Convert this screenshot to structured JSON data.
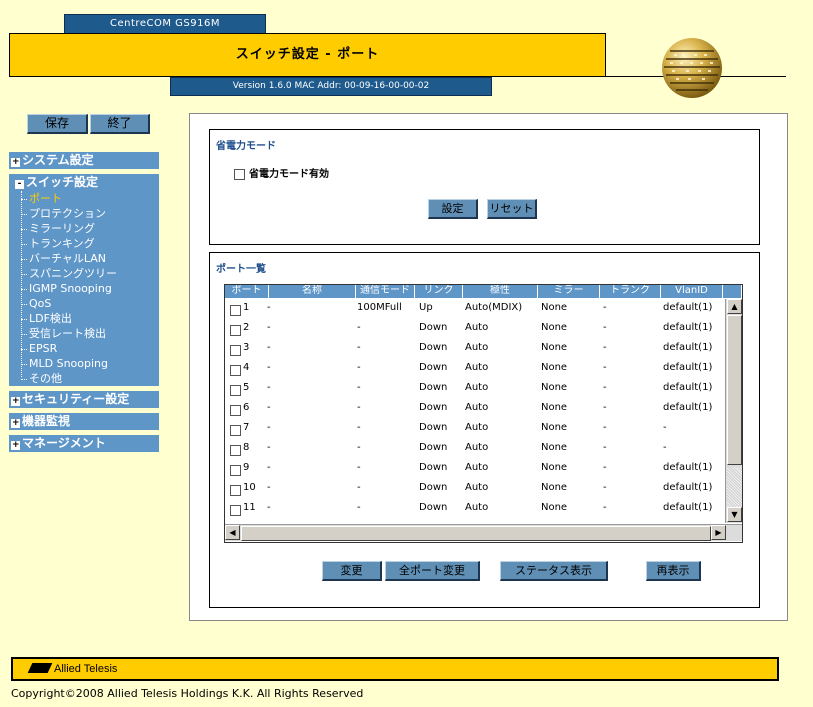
{
  "header": {
    "model": "CentreCOM GS916M",
    "title": "スイッチ設定 - ポート",
    "version": "Version 1.6.0 MAC Addr: 00-09-16-00-00-02"
  },
  "toolbar": {
    "save_label": "保存",
    "quit_label": "終了"
  },
  "sidebar": {
    "system": "システム設定",
    "switch": "スイッチ設定",
    "switch_items": [
      {
        "label": "ポート"
      },
      {
        "label": "プロテクション"
      },
      {
        "label": "ミラーリング"
      },
      {
        "label": "トランキング"
      },
      {
        "label": "バーチャルLAN"
      },
      {
        "label": "スパニングツリー"
      },
      {
        "label": "IGMP Snooping"
      },
      {
        "label": "QoS"
      },
      {
        "label": "LDF検出"
      },
      {
        "label": "受信レート検出"
      },
      {
        "label": "EPSR"
      },
      {
        "label": "MLD Snooping"
      },
      {
        "label": "その他"
      }
    ],
    "security": "セキュリティー設定",
    "monitor": "機器監視",
    "management": "マネージメント",
    "expand_glyph": "+",
    "collapse_glyph": "-"
  },
  "eco": {
    "legend": "省電力モード",
    "checkbox_label": "省電力モード有効",
    "set_label": "設定",
    "reset_label": "リセット"
  },
  "ports": {
    "legend": "ポート一覧",
    "columns": [
      "ポート",
      "名称",
      "通信モード",
      "リンク",
      "極性",
      "ミラー",
      "トランク",
      "VlanID"
    ],
    "rows": [
      [
        "1",
        "-",
        "100MFull",
        "Up",
        "Auto(MDIX)",
        "None",
        "-",
        "default(1)"
      ],
      [
        "2",
        "-",
        "-",
        "Down",
        "Auto",
        "None",
        "-",
        "default(1)"
      ],
      [
        "3",
        "-",
        "-",
        "Down",
        "Auto",
        "None",
        "-",
        "default(1)"
      ],
      [
        "4",
        "-",
        "-",
        "Down",
        "Auto",
        "None",
        "-",
        "default(1)"
      ],
      [
        "5",
        "-",
        "-",
        "Down",
        "Auto",
        "None",
        "-",
        "default(1)"
      ],
      [
        "6",
        "-",
        "-",
        "Down",
        "Auto",
        "None",
        "-",
        "default(1)"
      ],
      [
        "7",
        "-",
        "-",
        "Down",
        "Auto",
        "None",
        "-",
        "-"
      ],
      [
        "8",
        "-",
        "-",
        "Down",
        "Auto",
        "None",
        "-",
        "-"
      ],
      [
        "9",
        "-",
        "-",
        "Down",
        "Auto",
        "None",
        "-",
        "default(1)"
      ],
      [
        "10",
        "-",
        "-",
        "Down",
        "Auto",
        "None",
        "-",
        "default(1)"
      ],
      [
        "11",
        "-",
        "-",
        "Down",
        "Auto",
        "None",
        "-",
        "default(1)"
      ]
    ],
    "buttons": {
      "change": "変更",
      "change_all": "全ポート変更",
      "status": "ステータス表示",
      "refresh": "再表示"
    }
  },
  "footer": {
    "brand": "Allied Telesis",
    "copyright": "Copyright©2008 Allied Telesis Holdings K.K. All Rights Reserved"
  },
  "colors": {
    "accent_yellow": "#ffcc00",
    "nav_blue": "#5f96c8",
    "header_blue": "#1e5a8c",
    "page_bg": "#ffffd0"
  }
}
